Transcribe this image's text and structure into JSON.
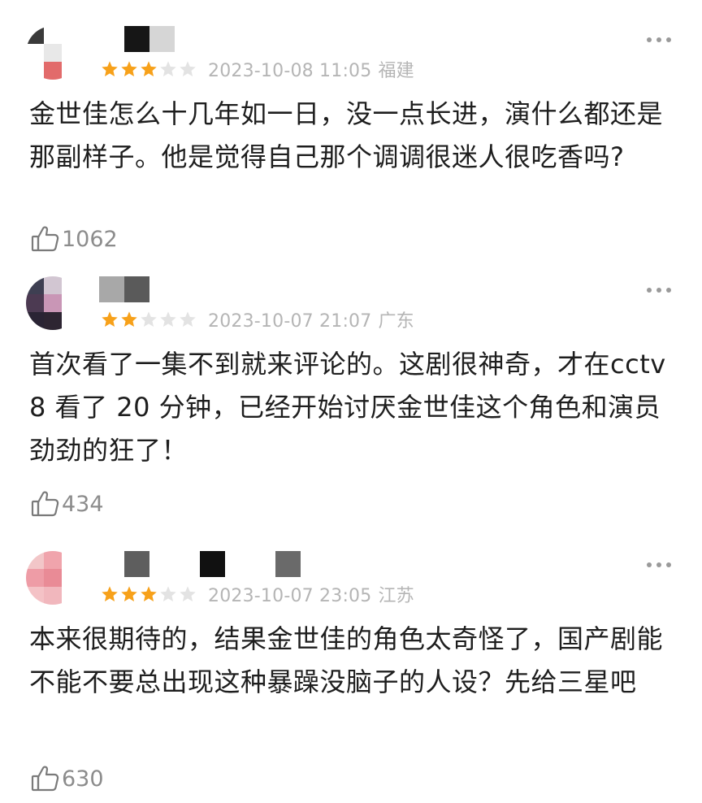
{
  "colors": {
    "star_filled": "#f7a11a",
    "star_empty": "#e3e3e3",
    "meta_text": "#b5b5b5",
    "body_text": "#1e1e1e",
    "like_text": "#8c8c8c"
  },
  "reviews": [
    {
      "rating": 3,
      "max_rating": 5,
      "date": "2023-10-08 11:05",
      "location": "福建",
      "content": "金世佳怎么十几年如一日，没一点长进，演什么都还是那副样子。他是觉得自己那个调调很迷人很吃香吗?",
      "likes": "1062",
      "like_icon": "thumbs-up-icon",
      "more_icon": "more-icon"
    },
    {
      "rating": 2,
      "max_rating": 5,
      "date": "2023-10-07 21:07",
      "location": "广东",
      "content": "首次看了一集不到就来评论的。这剧很神奇，才在cctv8 看了 20 分钟，已经开始讨厌金世佳这个角色和演员劲劲的狂了！",
      "likes": "434",
      "like_icon": "thumbs-up-icon",
      "more_icon": "more-icon"
    },
    {
      "rating": 3,
      "max_rating": 5,
      "date": "2023-10-07 23:05",
      "location": "江苏",
      "content": "本来很期待的，结果金世佳的角色太奇怪了，国产剧能不能不要总出现这种暴躁没脑子的人设？先给三星吧",
      "likes": "630",
      "like_icon": "thumbs-up-icon",
      "more_icon": "more-icon"
    }
  ]
}
